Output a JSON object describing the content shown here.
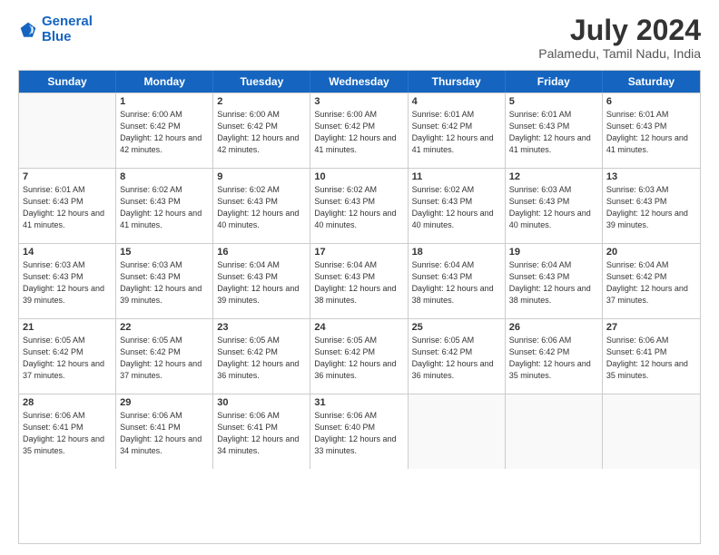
{
  "logo": {
    "line1": "General",
    "line2": "Blue"
  },
  "title": "July 2024",
  "location": "Palamedu, Tamil Nadu, India",
  "days_header": [
    "Sunday",
    "Monday",
    "Tuesday",
    "Wednesday",
    "Thursday",
    "Friday",
    "Saturday"
  ],
  "weeks": [
    [
      {
        "day": "",
        "empty": true
      },
      {
        "day": "1",
        "sunrise": "6:00 AM",
        "sunset": "6:42 PM",
        "daylight": "12 hours and 42 minutes."
      },
      {
        "day": "2",
        "sunrise": "6:00 AM",
        "sunset": "6:42 PM",
        "daylight": "12 hours and 42 minutes."
      },
      {
        "day": "3",
        "sunrise": "6:00 AM",
        "sunset": "6:42 PM",
        "daylight": "12 hours and 41 minutes."
      },
      {
        "day": "4",
        "sunrise": "6:01 AM",
        "sunset": "6:42 PM",
        "daylight": "12 hours and 41 minutes."
      },
      {
        "day": "5",
        "sunrise": "6:01 AM",
        "sunset": "6:43 PM",
        "daylight": "12 hours and 41 minutes."
      },
      {
        "day": "6",
        "sunrise": "6:01 AM",
        "sunset": "6:43 PM",
        "daylight": "12 hours and 41 minutes."
      }
    ],
    [
      {
        "day": "7",
        "sunrise": "6:01 AM",
        "sunset": "6:43 PM",
        "daylight": "12 hours and 41 minutes."
      },
      {
        "day": "8",
        "sunrise": "6:02 AM",
        "sunset": "6:43 PM",
        "daylight": "12 hours and 41 minutes."
      },
      {
        "day": "9",
        "sunrise": "6:02 AM",
        "sunset": "6:43 PM",
        "daylight": "12 hours and 40 minutes."
      },
      {
        "day": "10",
        "sunrise": "6:02 AM",
        "sunset": "6:43 PM",
        "daylight": "12 hours and 40 minutes."
      },
      {
        "day": "11",
        "sunrise": "6:02 AM",
        "sunset": "6:43 PM",
        "daylight": "12 hours and 40 minutes."
      },
      {
        "day": "12",
        "sunrise": "6:03 AM",
        "sunset": "6:43 PM",
        "daylight": "12 hours and 40 minutes."
      },
      {
        "day": "13",
        "sunrise": "6:03 AM",
        "sunset": "6:43 PM",
        "daylight": "12 hours and 39 minutes."
      }
    ],
    [
      {
        "day": "14",
        "sunrise": "6:03 AM",
        "sunset": "6:43 PM",
        "daylight": "12 hours and 39 minutes."
      },
      {
        "day": "15",
        "sunrise": "6:03 AM",
        "sunset": "6:43 PM",
        "daylight": "12 hours and 39 minutes."
      },
      {
        "day": "16",
        "sunrise": "6:04 AM",
        "sunset": "6:43 PM",
        "daylight": "12 hours and 39 minutes."
      },
      {
        "day": "17",
        "sunrise": "6:04 AM",
        "sunset": "6:43 PM",
        "daylight": "12 hours and 38 minutes."
      },
      {
        "day": "18",
        "sunrise": "6:04 AM",
        "sunset": "6:43 PM",
        "daylight": "12 hours and 38 minutes."
      },
      {
        "day": "19",
        "sunrise": "6:04 AM",
        "sunset": "6:43 PM",
        "daylight": "12 hours and 38 minutes."
      },
      {
        "day": "20",
        "sunrise": "6:04 AM",
        "sunset": "6:42 PM",
        "daylight": "12 hours and 37 minutes."
      }
    ],
    [
      {
        "day": "21",
        "sunrise": "6:05 AM",
        "sunset": "6:42 PM",
        "daylight": "12 hours and 37 minutes."
      },
      {
        "day": "22",
        "sunrise": "6:05 AM",
        "sunset": "6:42 PM",
        "daylight": "12 hours and 37 minutes."
      },
      {
        "day": "23",
        "sunrise": "6:05 AM",
        "sunset": "6:42 PM",
        "daylight": "12 hours and 36 minutes."
      },
      {
        "day": "24",
        "sunrise": "6:05 AM",
        "sunset": "6:42 PM",
        "daylight": "12 hours and 36 minutes."
      },
      {
        "day": "25",
        "sunrise": "6:05 AM",
        "sunset": "6:42 PM",
        "daylight": "12 hours and 36 minutes."
      },
      {
        "day": "26",
        "sunrise": "6:06 AM",
        "sunset": "6:42 PM",
        "daylight": "12 hours and 35 minutes."
      },
      {
        "day": "27",
        "sunrise": "6:06 AM",
        "sunset": "6:41 PM",
        "daylight": "12 hours and 35 minutes."
      }
    ],
    [
      {
        "day": "28",
        "sunrise": "6:06 AM",
        "sunset": "6:41 PM",
        "daylight": "12 hours and 35 minutes."
      },
      {
        "day": "29",
        "sunrise": "6:06 AM",
        "sunset": "6:41 PM",
        "daylight": "12 hours and 34 minutes."
      },
      {
        "day": "30",
        "sunrise": "6:06 AM",
        "sunset": "6:41 PM",
        "daylight": "12 hours and 34 minutes."
      },
      {
        "day": "31",
        "sunrise": "6:06 AM",
        "sunset": "6:40 PM",
        "daylight": "12 hours and 33 minutes."
      },
      {
        "day": "",
        "empty": true
      },
      {
        "day": "",
        "empty": true
      },
      {
        "day": "",
        "empty": true
      }
    ]
  ],
  "labels": {
    "sunrise_prefix": "Sunrise: ",
    "sunset_prefix": "Sunset: ",
    "daylight_prefix": "Daylight: "
  }
}
